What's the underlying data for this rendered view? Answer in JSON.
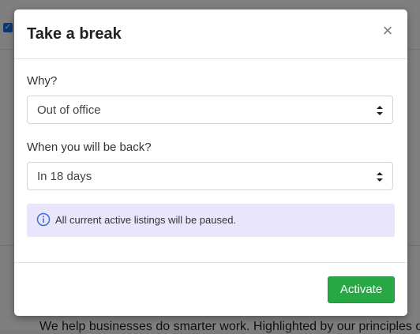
{
  "background": {
    "body_text": "We help businesses do smarter work. Highlighted by our principles of"
  },
  "modal": {
    "title": "Take a break",
    "close_icon": "close-icon",
    "fields": [
      {
        "label": "Why?",
        "value": "Out of office"
      },
      {
        "label": "When you will be back?",
        "value": "In 18 days"
      }
    ],
    "info": {
      "icon": "info-icon",
      "text": "All current active listings will be paused."
    },
    "activate_label": "Activate"
  },
  "colors": {
    "accent_green": "#28a745",
    "info_bg": "#e9e5fd",
    "info_icon": "#3b6fd4"
  }
}
